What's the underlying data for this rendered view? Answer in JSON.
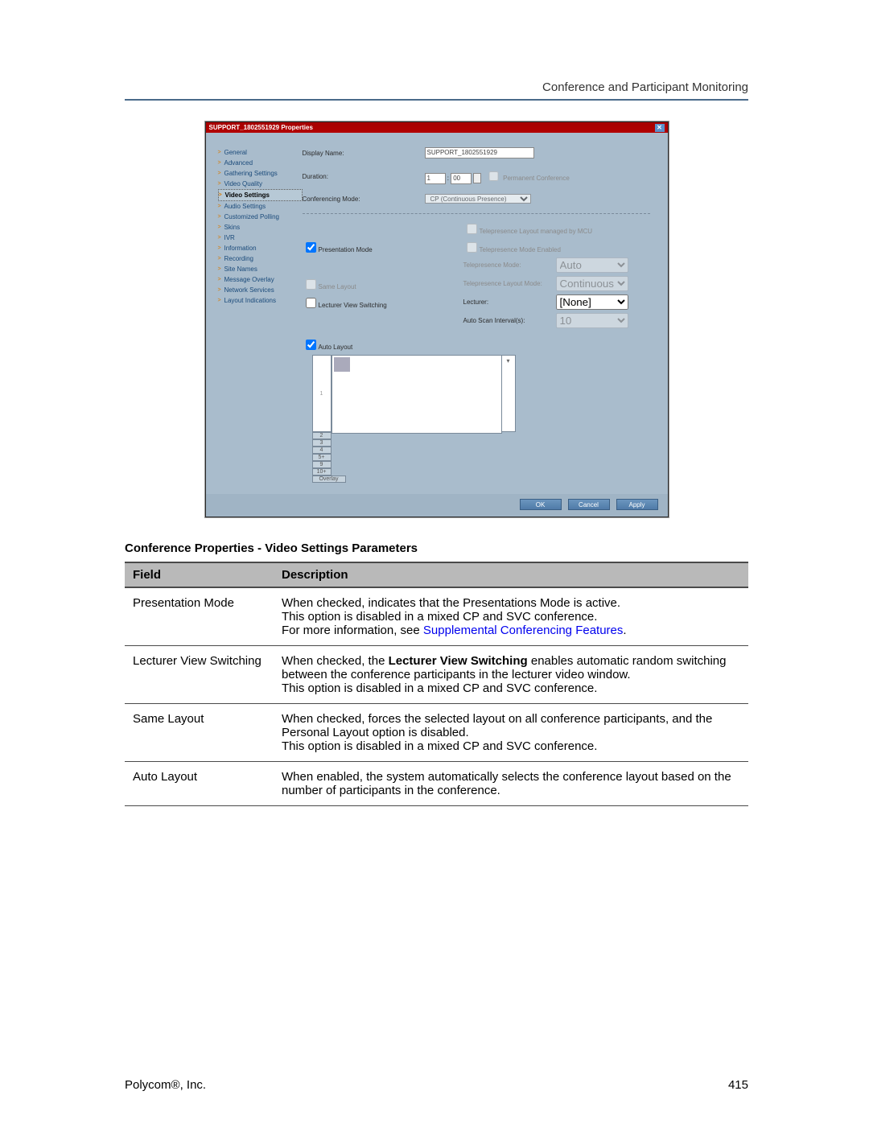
{
  "header": {
    "section": "Conference and Participant Monitoring"
  },
  "dialog": {
    "title": "SUPPORT_1802551929 Properties",
    "fields": {
      "display_name": {
        "label": "Display Name:",
        "value": "SUPPORT_1802551929"
      },
      "duration": {
        "label": "Duration:",
        "hours": "1",
        "minutes": "00",
        "permanent_label": "Permanent Conference"
      },
      "conferencing_mode": {
        "label": "Conferencing Mode:",
        "value": "CP (Continuous Presence)"
      },
      "tele_managed": "Telepresence Layout managed by MCU",
      "presentation_mode": "Presentation Mode",
      "tele_enabled": "Telepresence Mode Enabled",
      "tele_mode": {
        "label": "Telepresence Mode:",
        "value": "Auto"
      },
      "same_layout": "Same Layout",
      "tele_layout_mode": {
        "label": "Telepresence Layout Mode:",
        "value": "Continuous Presence (MU"
      },
      "lecturer_switch": "Lecturer View Switching",
      "lecturer": {
        "label": "Lecturer:",
        "value": "[None]"
      },
      "auto_scan": {
        "label": "Auto Scan Interval(s):",
        "value": "10"
      },
      "auto_layout": "Auto Layout"
    },
    "layout_tabs": [
      "1",
      "2",
      "3",
      "4",
      "5+",
      "9",
      "10+",
      "Overlay"
    ],
    "buttons": {
      "ok": "OK",
      "cancel": "Cancel",
      "apply": "Apply"
    }
  },
  "sidebar": [
    "General",
    "Advanced",
    "Gathering Settings",
    "Video Quality",
    "Video Settings",
    "Audio Settings",
    "Customized Polling",
    "Skins",
    "IVR",
    "Information",
    "Recording",
    "Site Names",
    "Message Overlay",
    "Network Services",
    "Layout Indications"
  ],
  "table": {
    "title": "Conference Properties - Video Settings Parameters",
    "head": {
      "field": "Field",
      "description": "Description"
    },
    "rows": [
      {
        "field": "Presentation Mode",
        "desc1": "When checked, indicates that the Presentations Mode is active.",
        "desc2": "This option is disabled in a mixed CP and SVC conference.",
        "desc3_pre": "For more information, see ",
        "desc3_link": "Supplemental Conferencing Features",
        "desc3_post": "."
      },
      {
        "field": "Lecturer View Switching",
        "desc1_pre": "When checked, the ",
        "desc1_bold": "Lecturer View Switching",
        "desc1_post": " enables automatic random switching between the conference participants in the lecturer video window.",
        "desc2": "This option is disabled in a mixed CP and SVC conference."
      },
      {
        "field": "Same Layout",
        "desc1": "When checked, forces the selected layout on all conference participants, and the Personal Layout option is disabled.",
        "desc2": "This option is disabled in a mixed CP and SVC conference."
      },
      {
        "field": "Auto Layout",
        "desc1": "When enabled, the system automatically selects the conference layout based on the number of participants in the conference."
      }
    ]
  },
  "footer": {
    "left": "Polycom®, Inc.",
    "right": "415"
  }
}
